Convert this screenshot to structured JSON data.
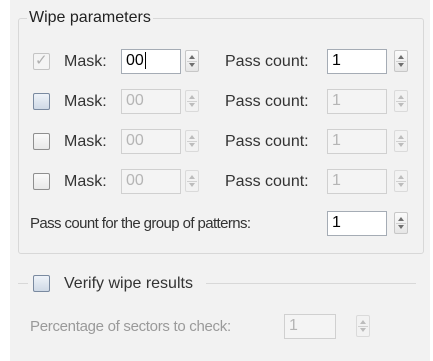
{
  "wipe_parameters": {
    "title": "Wipe parameters",
    "rows": [
      {
        "checked": true,
        "enabled": true,
        "mask_label": "Mask:",
        "mask_value": "00",
        "pass_label": "Pass count:",
        "pass_value": "1"
      },
      {
        "checked": false,
        "enabled": false,
        "mask_label": "Mask:",
        "mask_value": "00",
        "pass_label": "Pass count:",
        "pass_value": "1"
      },
      {
        "checked": false,
        "enabled": false,
        "mask_label": "Mask:",
        "mask_value": "00",
        "pass_label": "Pass count:",
        "pass_value": "1"
      },
      {
        "checked": false,
        "enabled": false,
        "mask_label": "Mask:",
        "mask_value": "00",
        "pass_label": "Pass count:",
        "pass_value": "1"
      }
    ],
    "group_pass_label": "Pass count for the group of patterns:",
    "group_pass_value": "1"
  },
  "verify": {
    "label": "Verify wipe results",
    "checked": false,
    "percentage_label": "Percentage of sectors to check:",
    "percentage_value": "1"
  },
  "icons": {
    "check": "check-icon",
    "spin_up": "spin-up-icon",
    "spin_down": "spin-down-icon"
  }
}
